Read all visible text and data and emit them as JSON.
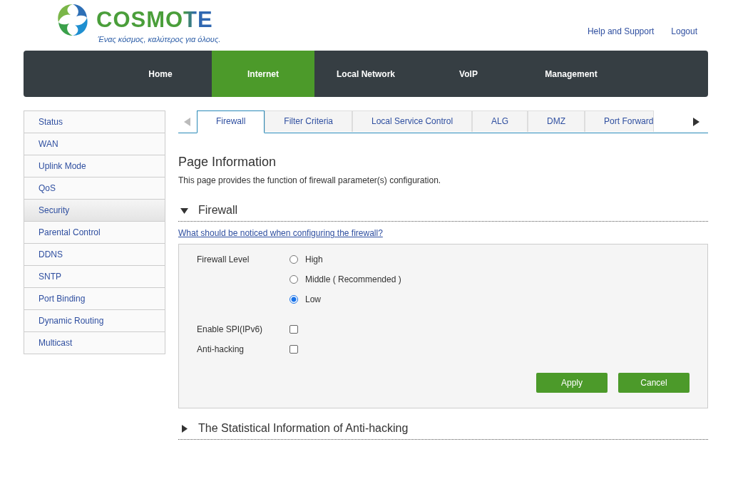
{
  "logo": {
    "name": "COSMOTE",
    "tagline": "Ένας κόσμος, καλύτερος για όλους."
  },
  "header_links": [
    "Help and Support",
    "Logout"
  ],
  "nav": [
    {
      "label": "Home",
      "selected": false
    },
    {
      "label": "Internet",
      "selected": true
    },
    {
      "label": "Local Network",
      "selected": false
    },
    {
      "label": "VoIP",
      "selected": false
    },
    {
      "label": "Management",
      "selected": false
    }
  ],
  "sidebar": {
    "items": [
      {
        "label": "Status",
        "selected": false
      },
      {
        "label": "WAN",
        "selected": false
      },
      {
        "label": "Uplink Mode",
        "selected": false
      },
      {
        "label": "QoS",
        "selected": false
      },
      {
        "label": "Security",
        "selected": true
      },
      {
        "label": "Parental Control",
        "selected": false
      },
      {
        "label": "DDNS",
        "selected": false
      },
      {
        "label": "SNTP",
        "selected": false
      },
      {
        "label": "Port Binding",
        "selected": false
      },
      {
        "label": "Dynamic Routing",
        "selected": false
      },
      {
        "label": "Multicast",
        "selected": false
      }
    ]
  },
  "tabs": [
    {
      "label": "Firewall",
      "selected": true
    },
    {
      "label": "Filter Criteria",
      "selected": false
    },
    {
      "label": "Local Service Control",
      "selected": false
    },
    {
      "label": "ALG",
      "selected": false
    },
    {
      "label": "DMZ",
      "selected": false
    },
    {
      "label": "Port Forward",
      "selected": false
    }
  ],
  "page_info": {
    "title": "Page Information",
    "description": "This page provides the function of firewall parameter(s) configuration."
  },
  "firewall_section": {
    "title": "Firewall",
    "expanded": true,
    "help_link": "What should be noticed when configuring the firewall?",
    "level_label": "Firewall Level",
    "levels": [
      {
        "label": "High",
        "selected": false
      },
      {
        "label": "Middle ( Recommended )",
        "selected": false
      },
      {
        "label": "Low",
        "selected": true
      }
    ],
    "options": [
      {
        "label": "Enable SPI(IPv6)",
        "checked": false
      },
      {
        "label": "Anti-hacking",
        "checked": false
      }
    ],
    "buttons": [
      "Apply",
      "Cancel"
    ]
  },
  "stats_section": {
    "title": "The Statistical Information of Anti-hacking",
    "expanded": false
  }
}
